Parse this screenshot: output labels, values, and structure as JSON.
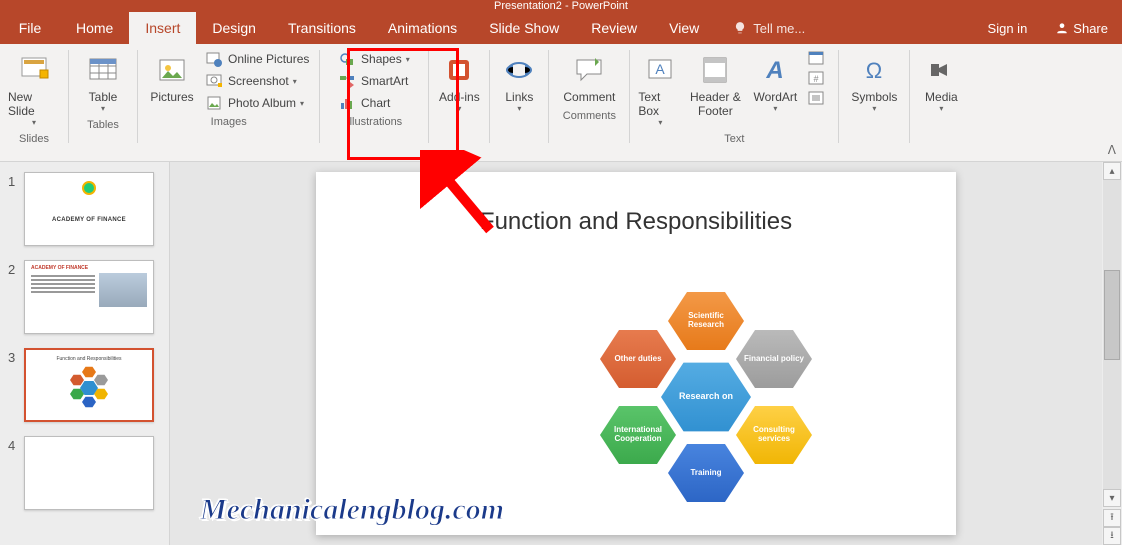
{
  "titlebar": {
    "title": "Presentation2 - PowerPoint"
  },
  "tabs": {
    "file": "File",
    "items": [
      {
        "label": "Home"
      },
      {
        "label": "Insert",
        "active": true
      },
      {
        "label": "Design"
      },
      {
        "label": "Transitions"
      },
      {
        "label": "Animations"
      },
      {
        "label": "Slide Show"
      },
      {
        "label": "Review"
      },
      {
        "label": "View"
      }
    ],
    "tellme": "Tell me...",
    "signin": "Sign in",
    "share": "Share"
  },
  "ribbon": {
    "groups": {
      "slides": {
        "title": "Slides",
        "new_slide": "New Slide"
      },
      "tables": {
        "title": "Tables",
        "table": "Table"
      },
      "images": {
        "title": "Images",
        "pictures": "Pictures",
        "online_pictures": "Online Pictures",
        "screenshot": "Screenshot",
        "photo_album": "Photo Album"
      },
      "illustrations": {
        "title": "Illustrations",
        "shapes": "Shapes",
        "smartart": "SmartArt",
        "chart": "Chart"
      },
      "addins": {
        "title": "",
        "addins": "Add-ins"
      },
      "links": {
        "title": "",
        "links": "Links"
      },
      "comments": {
        "title": "Comments",
        "comment": "Comment"
      },
      "text": {
        "title": "Text",
        "textbox": "Text Box",
        "header_footer": "Header & Footer",
        "wordart": "WordArt"
      },
      "symbols": {
        "title": "",
        "symbols": "Symbols"
      },
      "media": {
        "title": "",
        "media": "Media"
      }
    }
  },
  "thumbs": [
    {
      "num": "1",
      "title": "ACADEMY OF FINANCE",
      "selected": false,
      "kind": "title"
    },
    {
      "num": "2",
      "title": "ACADEMY OF FINANCE",
      "selected": false,
      "kind": "content"
    },
    {
      "num": "3",
      "title": "Function and Responsibilities",
      "selected": true,
      "kind": "hex"
    },
    {
      "num": "4",
      "title": "",
      "selected": false,
      "kind": "blank"
    }
  ],
  "slide": {
    "title": "Function and Responsibilities",
    "hex": {
      "center": {
        "label": "Research on",
        "color": "#2f8fd0"
      },
      "around": [
        {
          "label": "Scientific Research",
          "color": "#e67817",
          "pos": "top"
        },
        {
          "label": "Financial policy",
          "color": "#9a9a9a",
          "pos": "tr"
        },
        {
          "label": "Consulting services",
          "color": "#f0b400",
          "pos": "br"
        },
        {
          "label": "Training",
          "color": "#2b64c4",
          "pos": "bottom"
        },
        {
          "label": "International Cooperation",
          "color": "#3aa84a",
          "pos": "bl"
        },
        {
          "label": "Other duties",
          "color": "#d35b2e",
          "pos": "tl"
        }
      ]
    }
  },
  "watermark": "Mechanicalengblog.com"
}
